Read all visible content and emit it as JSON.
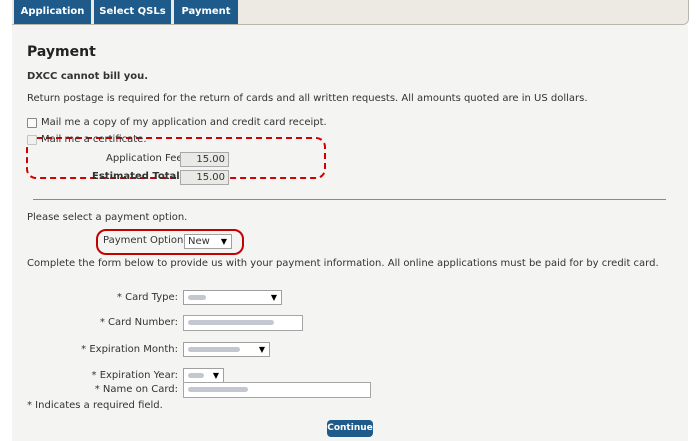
{
  "tabs": [
    {
      "label": "Application"
    },
    {
      "label": "Select QSLs"
    },
    {
      "label": "Payment"
    }
  ],
  "payment": {
    "title": "Payment",
    "notice": "DXCC cannot bill you.",
    "postage_text": "Return postage is required for the return of cards and all written requests. All amounts quoted are in US dollars.",
    "checkbox_receipt_label": "Mail me a copy of my application and credit card receipt.",
    "checkbox_certificate_label": "Mail me a certificate.",
    "application_fee_label": "Application Fee:",
    "application_fee_value": "15.00",
    "estimated_total_label": "Estimated Total:",
    "estimated_total_value": "15.00",
    "select_option_text": "Please select a payment option.",
    "payment_option_label": "Payment Option:",
    "payment_option_value": "New",
    "complete_form_text": "Complete the form below to provide us with your payment information. All online applications must be paid for by credit card."
  },
  "card_form": {
    "card_type_label": "* Card Type:",
    "card_number_label": "* Card Number:",
    "expiration_month_label": "* Expiration Month:",
    "expiration_year_label": "* Expiration Year:",
    "name_on_card_label": "* Name on Card:",
    "required_note": "* Indicates a required field."
  },
  "continue_label": "Continue",
  "colors": {
    "tab_bg": "#1f5b8a",
    "highlight_red": "#d40000",
    "panel_bg": "#f4f4f2"
  }
}
